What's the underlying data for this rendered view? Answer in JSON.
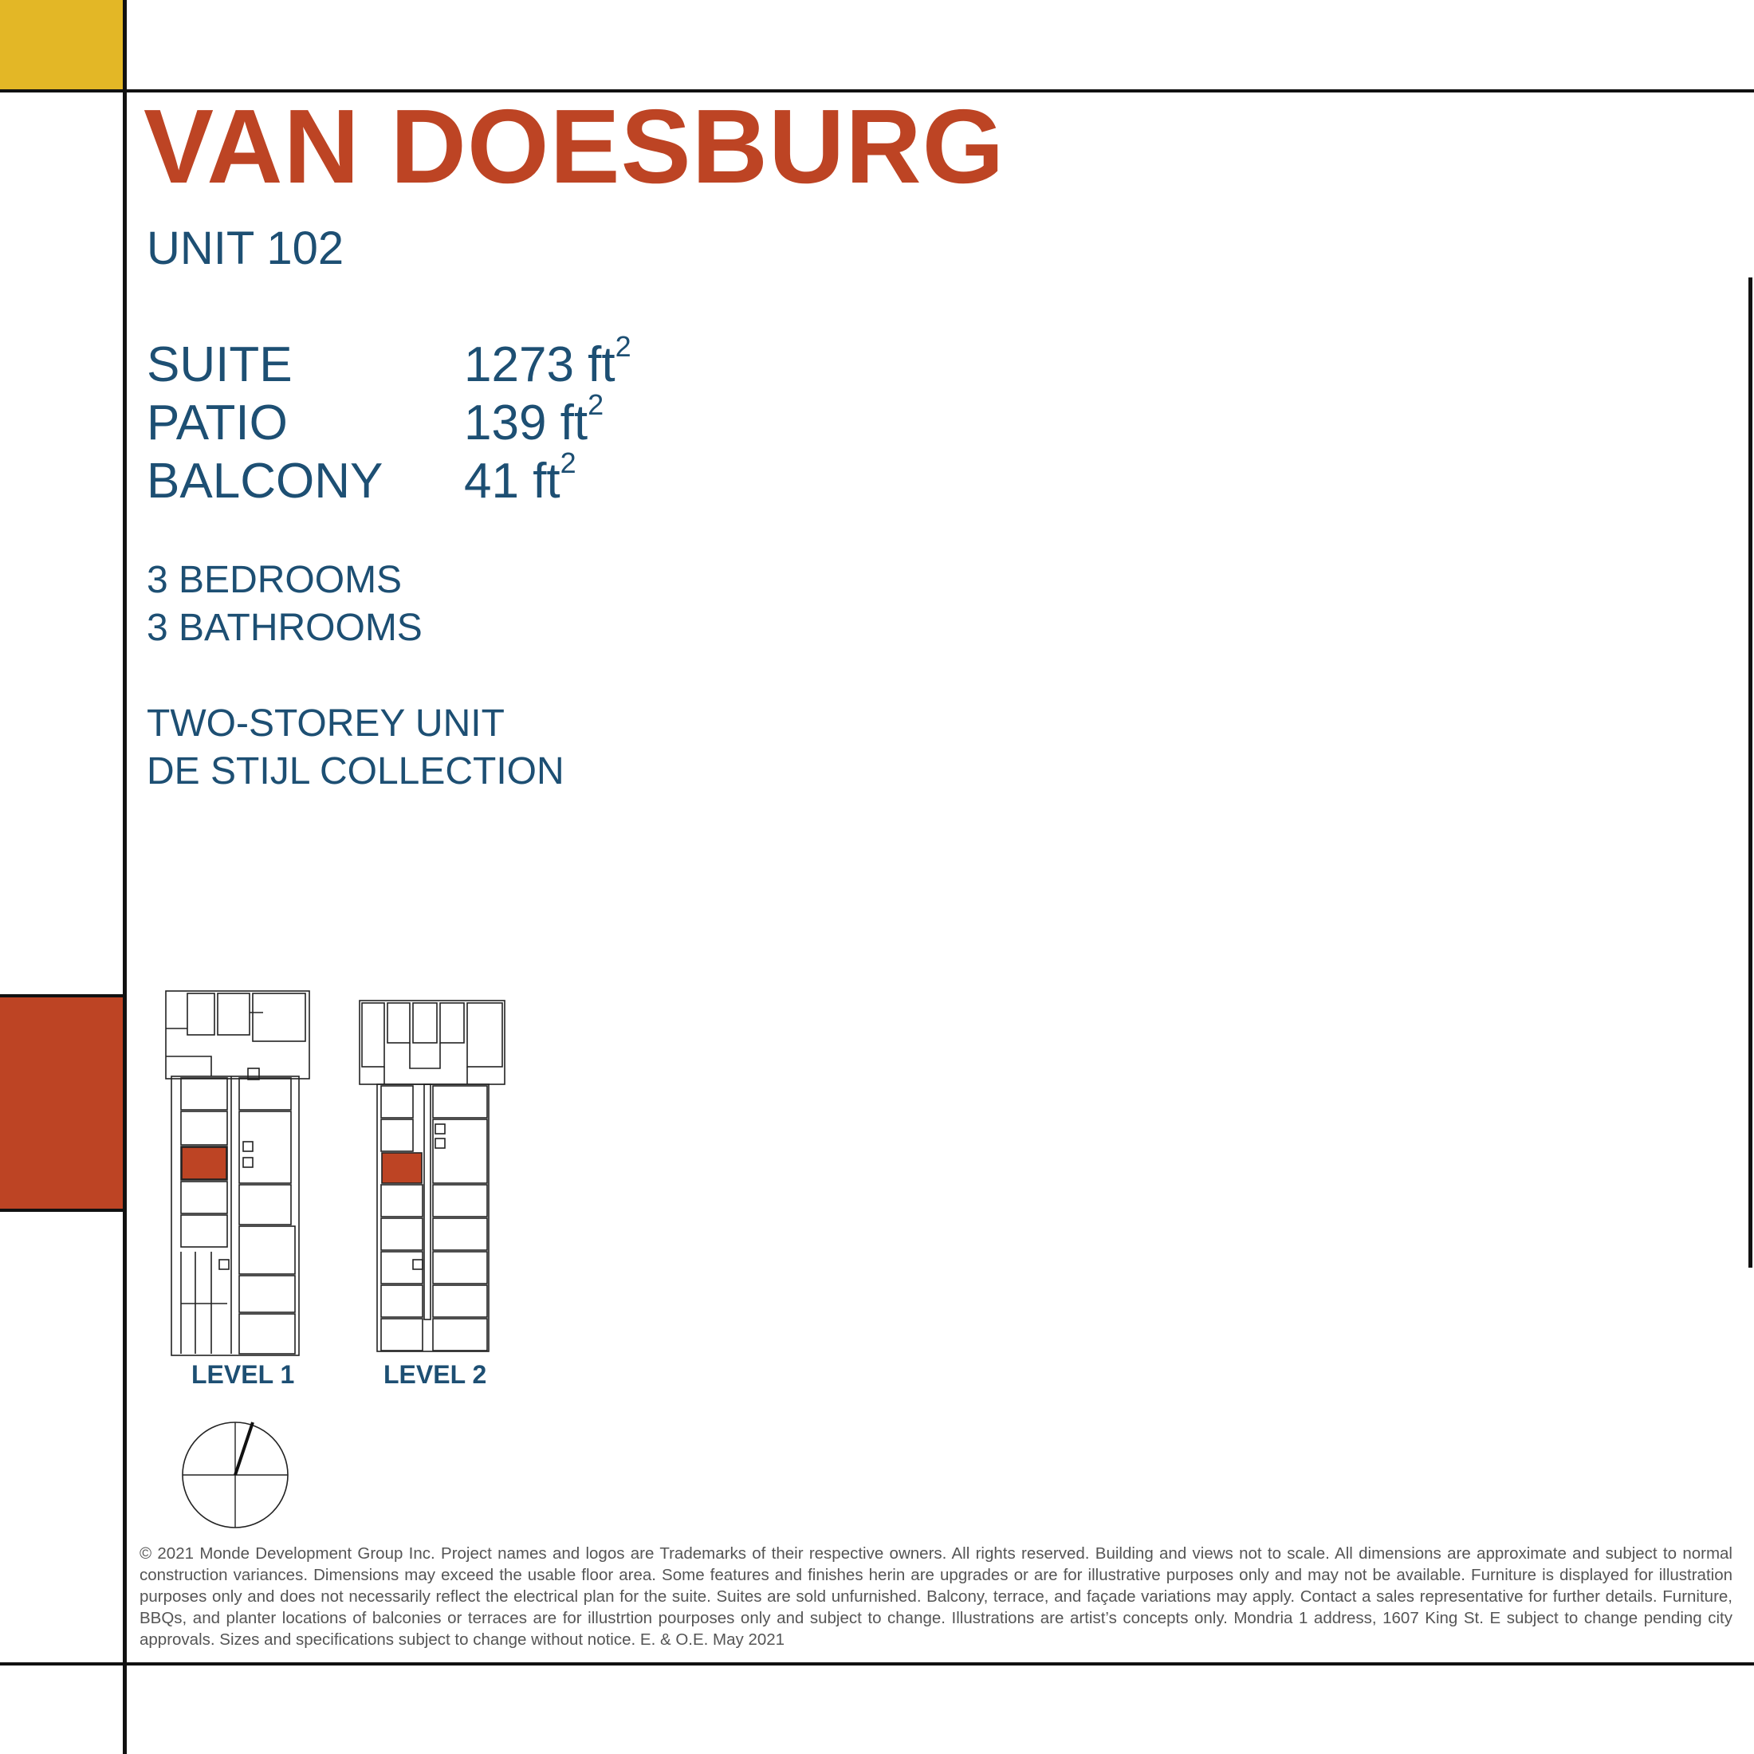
{
  "title": "VAN DOESBURG",
  "unit": "UNIT 102",
  "specs": [
    {
      "label": "SUITE",
      "value": "1273 ft",
      "unit_sup": "2"
    },
    {
      "label": "PATIO",
      "value": "139 ft",
      "unit_sup": "2"
    },
    {
      "label": "BALCONY",
      "value": "41 ft",
      "unit_sup": "2"
    }
  ],
  "rooms": {
    "bedrooms": "3 BEDROOMS",
    "bathrooms": "3 BATHROOMS"
  },
  "details": {
    "type": "TWO-STOREY UNIT",
    "collection": "DE STIJL COLLECTION"
  },
  "levels": {
    "level1": "LEVEL 1",
    "level2": "LEVEL 2"
  },
  "colors": {
    "accent_red": "#bd4424",
    "accent_yellow": "#e3b726",
    "text_blue": "#1d4f73"
  },
  "footer": "© 2021 Monde Development Group Inc.  Project names and logos are Trademarks of their respective owners.  All rights reserved.  Building and views not to scale.  All dimensions are approximate and subject to normal construction variances.  Dimensions may exceed the usable floor area.  Some features and finishes herin are upgrades or are for illustrative purposes only and may not be available.  Furniture is displayed for illustration purposes only and does not necessarily reflect the electrical plan for the suite.  Suites are sold unfurnished.  Balcony, terrace, and façade variations may apply.  Contact a sales representative for further details.  Furniture, BBQs, and planter locations of balconies or terraces are for illustrtion pourposes only and subject to change.  Illustrations are artist’s concepts only.  Mondria 1 address, 1607 King St. E subject to change pending city approvals.  Sizes and specifications subject to change without notice. E. & O.E. May 2021"
}
